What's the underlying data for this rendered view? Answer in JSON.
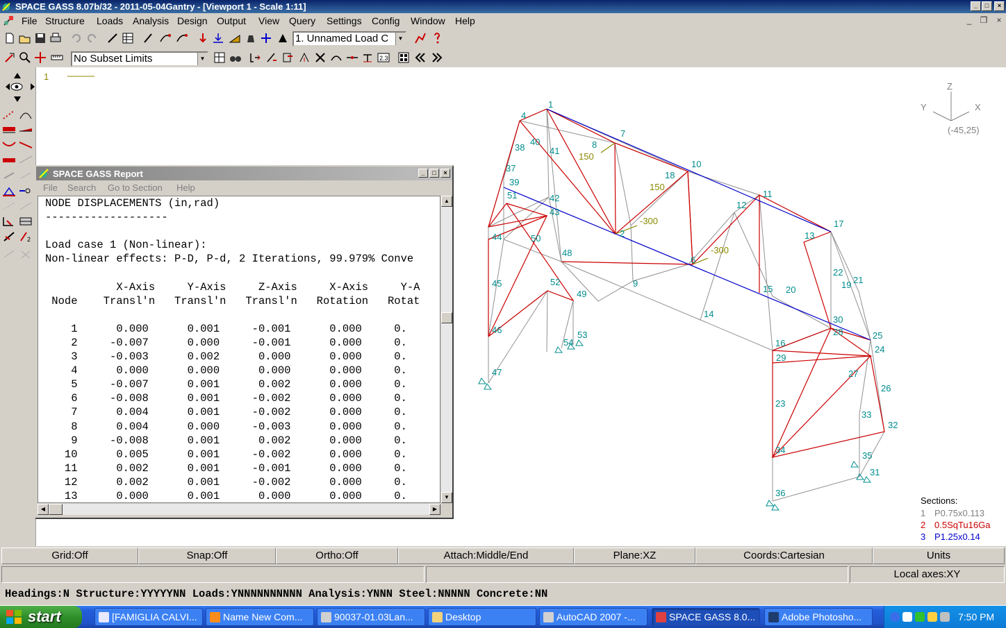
{
  "app": {
    "title": "SPACE GASS 8.07b/32 - 2011-05-04Gantry - [Viewport 1 - Scale 1:11]"
  },
  "menu": [
    "File",
    "Structure",
    "Loads",
    "Analysis",
    "Design",
    "Output",
    "View",
    "Query",
    "Settings",
    "Config",
    "Window",
    "Help"
  ],
  "toolbar": {
    "load_case": "1. Unnamed Load C",
    "subset": "No Subset Limits"
  },
  "viewport": {
    "load_case_index": "1",
    "axes": {
      "z": "Z",
      "y": "Y",
      "x": "X",
      "angles": "(-45,25)"
    },
    "nodes": [
      "1",
      "2",
      "4",
      "6",
      "7",
      "8",
      "9",
      "10",
      "11",
      "12",
      "13",
      "14",
      "15",
      "16",
      "17",
      "18",
      "19",
      "20",
      "21",
      "22",
      "23",
      "24",
      "25",
      "26",
      "27",
      "28",
      "29",
      "30",
      "31",
      "32",
      "33",
      "34",
      "35",
      "36",
      "37",
      "38",
      "39",
      "40",
      "41",
      "42",
      "43",
      "44",
      "45",
      "46",
      "47",
      "48",
      "49",
      "50",
      "51",
      "52",
      "53",
      "54"
    ],
    "load_labels": [
      "150",
      "150",
      "-300",
      "-300"
    ],
    "sections_title": "Sections:",
    "sections": [
      {
        "num": "1",
        "name": "P0.75x0.113",
        "color": "#808080"
      },
      {
        "num": "2",
        "name": "0.5SqTu16Ga",
        "color": "#cc0000"
      },
      {
        "num": "3",
        "name": "P1.25x0.14",
        "color": "#0000cc"
      }
    ]
  },
  "report": {
    "title": "SPACE GASS Report",
    "menu": [
      "File",
      "Search",
      "Go to Section",
      "Help"
    ],
    "heading": "NODE DISPLACEMENTS (in,rad)",
    "underline": "-------------------",
    "load_case_line": "Load case 1 (Non-linear):",
    "effects_line": "Non-linear effects: P-D, P-d, 2 Iterations, 99.979% Conve",
    "columns_top": [
      "X-Axis",
      "Y-Axis",
      "Z-Axis",
      "X-Axis",
      "Y-A"
    ],
    "columns_bottom": [
      "Node",
      "Transl'n",
      "Transl'n",
      "Transl'n",
      "Rotation",
      "Rotat"
    ],
    "rows": [
      [
        "1",
        "0.000",
        "0.001",
        "-0.001",
        "0.000",
        "0."
      ],
      [
        "2",
        "-0.007",
        "0.000",
        "-0.001",
        "0.000",
        "0."
      ],
      [
        "3",
        "-0.003",
        "0.002",
        "0.000",
        "0.000",
        "0."
      ],
      [
        "4",
        "0.000",
        "0.000",
        "0.000",
        "0.000",
        "0."
      ],
      [
        "5",
        "-0.007",
        "0.001",
        "0.002",
        "0.000",
        "0."
      ],
      [
        "6",
        "-0.008",
        "0.001",
        "-0.002",
        "0.000",
        "0."
      ],
      [
        "7",
        "0.004",
        "0.001",
        "-0.002",
        "0.000",
        "0."
      ],
      [
        "8",
        "0.004",
        "0.000",
        "-0.003",
        "0.000",
        "0."
      ],
      [
        "9",
        "-0.008",
        "0.001",
        "0.002",
        "0.000",
        "0."
      ],
      [
        "10",
        "0.005",
        "0.001",
        "-0.002",
        "0.000",
        "0."
      ],
      [
        "11",
        "0.002",
        "0.001",
        "-0.001",
        "0.000",
        "0."
      ],
      [
        "12",
        "0.002",
        "0.001",
        "-0.002",
        "0.000",
        "0."
      ],
      [
        "13",
        "0.000",
        "0.001",
        "0.000",
        "0.000",
        "0."
      ]
    ]
  },
  "status": {
    "grid": "Grid:Off",
    "snap": "Snap:Off",
    "ortho": "Ortho:Off",
    "attach": "Attach:Middle/End",
    "plane": "Plane:XZ",
    "coords": "Coords:Cartesian",
    "units": "Units",
    "local_axes": "Local axes:XY",
    "headings": "Headings:N Structure:YYYYYNN Loads:YNNNNNNNNNN Analysis:YNNN Steel:NNNNN Concrete:NN"
  },
  "taskbar": {
    "start": "start",
    "tasks": [
      {
        "label": "[FAMIGLIA CALVI...",
        "color": "#e8e8ff"
      },
      {
        "label": "Name New Com...",
        "color": "#ff8c1a"
      },
      {
        "label": "90037-01.03Lan...",
        "color": "#d0d0d0"
      },
      {
        "label": "Desktop",
        "color": "#f2d27a"
      },
      {
        "label": "AutoCAD 2007 -...",
        "color": "#d0d0d0"
      },
      {
        "label": "SPACE GASS 8.0...",
        "color": "#e04040"
      },
      {
        "label": "Adobe Photosho...",
        "color": "#1e3c6e"
      }
    ],
    "clock": "7:50 PM"
  }
}
